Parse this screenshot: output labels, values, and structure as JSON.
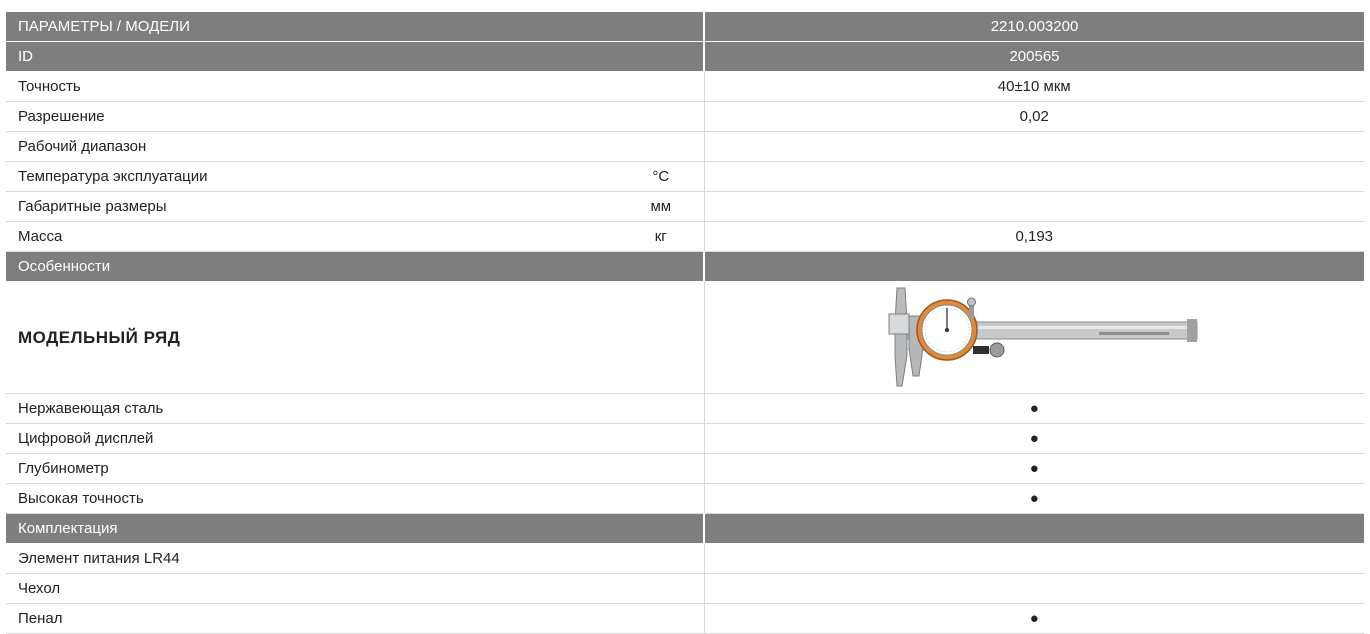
{
  "table": {
    "header": {
      "label": "ПАРАМЕТРЫ / МОДЕЛИ",
      "model": "2210.003200"
    },
    "id_row": {
      "label": "ID",
      "value": "200565"
    },
    "rows": [
      {
        "label": "Точность",
        "unit": "",
        "value": "40±10 мкм"
      },
      {
        "label": "Разрешение",
        "unit": "",
        "value": "0,02"
      },
      {
        "label": "Рабочий диапазон",
        "unit": "",
        "value": ""
      },
      {
        "label": "Температура эксплуатации",
        "unit": "°C",
        "value": ""
      },
      {
        "label": "Габаритные размеры",
        "unit": "мм",
        "value": ""
      },
      {
        "label": "Масса",
        "unit": "кг",
        "value": "0,193"
      }
    ],
    "features_section": {
      "label": "Особенности"
    },
    "model_row": {
      "label": "МОДЕЛЬНЫЙ РЯД",
      "image": "caliper-image"
    },
    "features": [
      {
        "label": "Нержавеющая сталь",
        "value": "●"
      },
      {
        "label": "Цифровой дисплей",
        "value": "●"
      },
      {
        "label": "Глубинометр",
        "value": "●"
      },
      {
        "label": "Высокая точность",
        "value": "●"
      }
    ],
    "kit_section": {
      "label": "Комплектация"
    },
    "kit": [
      {
        "label": "Элемент питания LR44",
        "value": ""
      },
      {
        "label": "Чехол",
        "value": ""
      },
      {
        "label": "Пенал",
        "value": "●"
      }
    ]
  },
  "colors": {
    "header_gray": "#7e7e7e",
    "title_red": "#e2231a"
  }
}
